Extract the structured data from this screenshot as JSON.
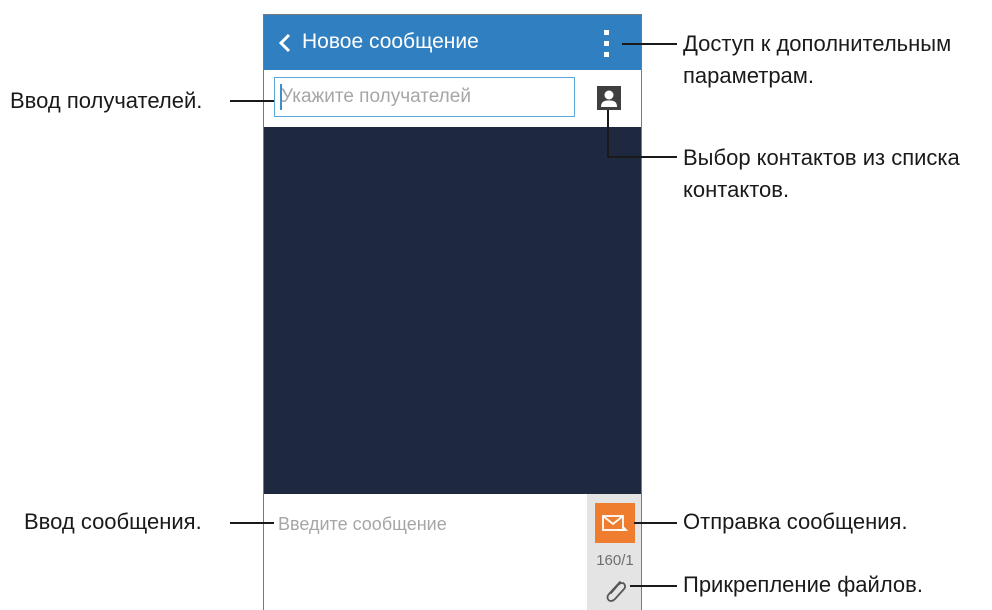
{
  "header": {
    "title": "Новое сообщение"
  },
  "recipients": {
    "placeholder": "Укажите получателей"
  },
  "compose": {
    "placeholder": "Введите сообщение",
    "counter": "160/1"
  },
  "colors": {
    "appbar": "#2f7fc1",
    "send": "#ef7d2f",
    "thread_background": "#1e2940"
  },
  "icons": [
    "back-arrow-icon",
    "more-options-icon",
    "contact-icon",
    "envelope-icon",
    "paperclip-icon"
  ],
  "callouts": {
    "recipient_entry": "Ввод получателей.",
    "more_options_line1": "Доступ к дополнительным",
    "more_options_line2": "параметрам.",
    "contacts_line1": "Выбор контактов из списка",
    "contacts_line2": "контактов.",
    "message_entry": "Ввод сообщения.",
    "send": "Отправка сообщения.",
    "attach": "Прикрепление файлов."
  }
}
